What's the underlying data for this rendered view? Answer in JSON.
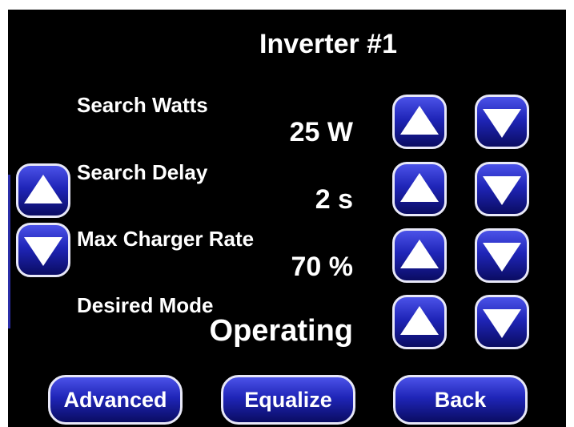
{
  "title": "Inverter #1",
  "settings": [
    {
      "label": "Search Watts",
      "value": "25 W"
    },
    {
      "label": "Search Delay",
      "value": "2 s"
    },
    {
      "label": "Max Charger Rate",
      "value": "70 %"
    },
    {
      "label": "Desired Mode",
      "value": "Operating"
    }
  ],
  "buttons": {
    "advanced": "Advanced",
    "equalize": "Equalize",
    "back": "Back"
  },
  "icons": {
    "up": "triangle-up-icon",
    "down": "triangle-down-icon"
  },
  "colors": {
    "background": "#000000",
    "button_top": "#4b52e8",
    "button_bottom": "#0a0c62",
    "text": "#ffffff"
  }
}
